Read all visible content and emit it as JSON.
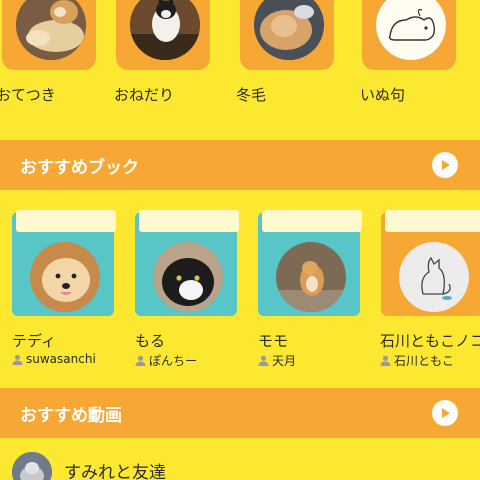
{
  "categories": [
    {
      "label": "おてつき",
      "photo_icon": "cat-paws-photo"
    },
    {
      "label": "おねだり",
      "photo_icon": "cat-begging-photo"
    },
    {
      "label": "冬毛",
      "photo_icon": "fluffy-cat-photo"
    },
    {
      "label": "いぬ句",
      "photo_icon": "dog-drawing-photo"
    }
  ],
  "recommended_books": {
    "title": "おすすめブック",
    "more_icon": "play-circle-icon",
    "items": [
      {
        "title": "テディ",
        "author": "suwasanchi",
        "cover_color": "#58c5c7"
      },
      {
        "title": "もる",
        "author": "ぽんちー",
        "cover_color": "#58c5c7"
      },
      {
        "title": "モモ",
        "author": "天月",
        "cover_color": "#58c5c7"
      },
      {
        "title": "石川ともこノコ",
        "author": "石川ともこ",
        "cover_color": "#f7a733"
      }
    ]
  },
  "recommended_videos": {
    "title": "おすすめ動画",
    "more_icon": "play-circle-icon",
    "items": [
      {
        "title": "すみれと友達"
      }
    ]
  },
  "colors": {
    "background": "#fde831",
    "accent_orange": "#f7a733",
    "book_teal": "#58c5c7"
  }
}
